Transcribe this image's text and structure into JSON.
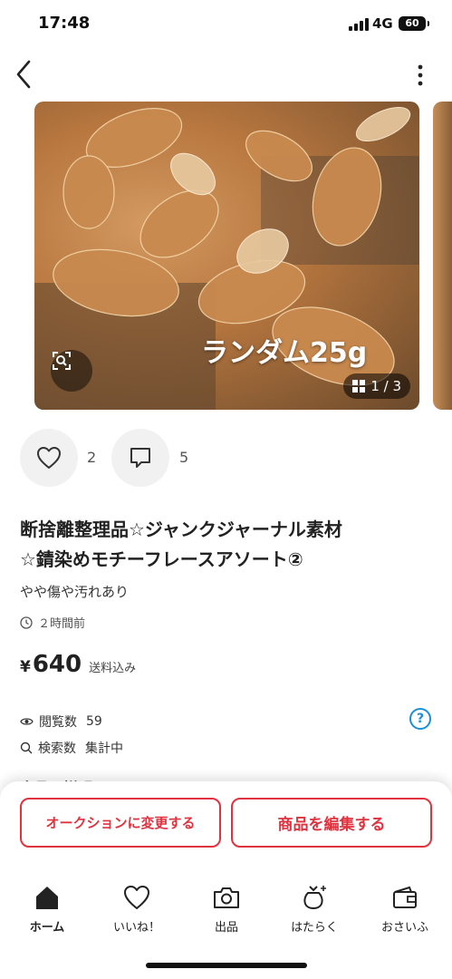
{
  "status_bar": {
    "time": "17:48",
    "network": "4G",
    "battery": "60"
  },
  "listing": {
    "image_overlay_text": "ランダム25g",
    "image_counter": "1 / 3",
    "likes_count": "2",
    "comments_count": "5",
    "title_line1": "断捨離整理品☆ジャンクジャーナル素材",
    "title_line2": "☆錆染めモチーフレースアソート②",
    "condition": "やや傷や汚れあり",
    "posted": "２時間前",
    "price_currency": "¥",
    "price": "640",
    "shipping": "送料込み",
    "views_label": "閲覧数",
    "views_value": "59",
    "search_label": "検索数",
    "search_value": "集計中",
    "section_title_peek": "商品の説明"
  },
  "actions": {
    "auction_button": "オークションに変更する",
    "edit_button": "商品を編集する"
  },
  "tabbar": {
    "items": [
      {
        "label": "ホーム",
        "icon": "home-icon",
        "active": true
      },
      {
        "label": "いいね！",
        "icon": "heart-icon",
        "active": false
      },
      {
        "label": "出品",
        "icon": "camera-icon",
        "active": false
      },
      {
        "label": "はたらく",
        "icon": "money-bag-icon",
        "active": false
      },
      {
        "label": "おさいふ",
        "icon": "wallet-icon",
        "active": false
      }
    ]
  },
  "colors": {
    "accent": "#e0333f",
    "help": "#1a8fd8"
  }
}
